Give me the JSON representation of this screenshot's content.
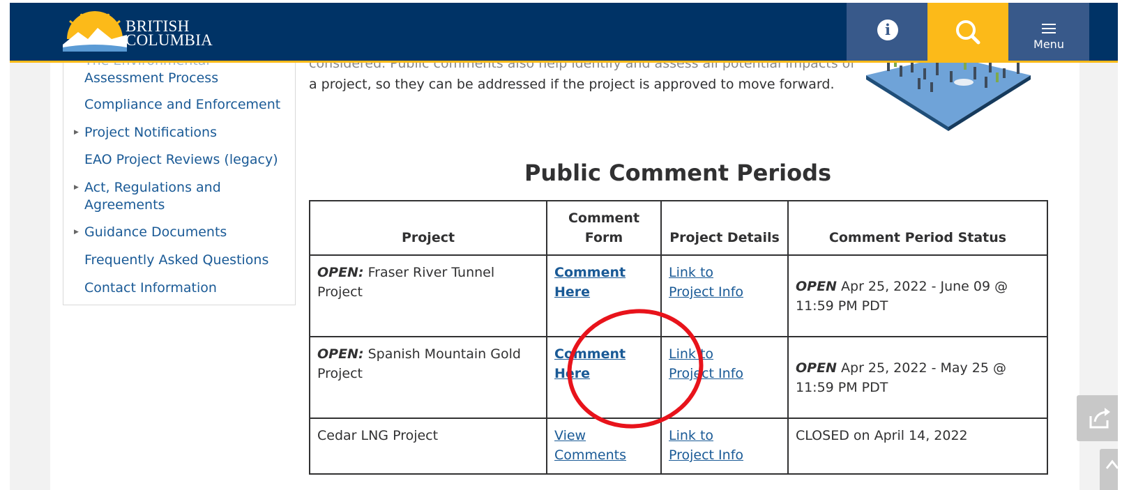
{
  "header": {
    "logo_line1": "BRITISH",
    "logo_line2": "COLUMBIA",
    "info_icon": "info-icon",
    "search_icon": "search-icon",
    "menu_icon": "hamburger-menu-icon",
    "menu_label": "Menu",
    "colors": {
      "bar": "#003366",
      "accent": "#fcba19",
      "button": "#38598a"
    }
  },
  "sidebar": {
    "items": [
      {
        "label": "The Environmental Assessment Process",
        "line1": "The Environmental",
        "line2": "Assessment Process",
        "expandable": false
      },
      {
        "label": "Compliance and Enforcement",
        "expandable": false
      },
      {
        "label": "Project Notifications",
        "expandable": true
      },
      {
        "label": "EAO Project Reviews (legacy)",
        "expandable": false
      },
      {
        "label": "Act, Regulations and Agreements",
        "line1": "Act, Regulations and",
        "line2": "Agreements",
        "expandable": true
      },
      {
        "label": "Guidance Documents",
        "expandable": true
      },
      {
        "label": "Frequently Asked Questions",
        "expandable": false
      },
      {
        "label": "Contact Information",
        "expandable": false
      }
    ]
  },
  "main": {
    "intro_line1": "considered. Public comments also help identify and assess all potential impacts of",
    "intro_line2": "a project, so they can be addressed if the project is approved to move forward.",
    "section_title": "Public Comment Periods",
    "table": {
      "headers": [
        "Project",
        "Comment Form",
        "Project Details",
        "Comment Period Status"
      ],
      "header_comment_form_line1": "Comment",
      "header_comment_form_line2": "Form",
      "rows": [
        {
          "project_prefix": "OPEN:",
          "project_name": "Fraser River Tunnel Project",
          "comment_link_line1": "Comment",
          "comment_link_line2": "Here",
          "details_link_line1": "Link to",
          "details_link_line2": "Project Info",
          "status_prefix": "OPEN",
          "status_text": "Apr 25, 2022 - June 09 @ 11:59 PM PDT"
        },
        {
          "project_prefix": "OPEN:",
          "project_name": "Spanish Mountain Gold Project",
          "comment_link_line1": "Comment",
          "comment_link_line2": "Here",
          "details_link_line1": "Link to",
          "details_link_line2": "Project Info",
          "status_prefix": "OPEN",
          "status_text": "Apr 25, 2022 - May 25 @ 11:59 PM PDT"
        },
        {
          "project_prefix": "",
          "project_name": "Cedar LNG Project",
          "comment_link_line1": "View",
          "comment_link_line2": "Comments",
          "details_link_line1": "Link to",
          "details_link_line2": "Project Info",
          "status_prefix": "",
          "status_text": "CLOSED on April 14, 2022"
        }
      ]
    }
  },
  "floating": {
    "share_icon": "share-icon",
    "back_to_top_icon": "chevron-up-icon"
  },
  "annotation": {
    "type": "highlight-circle",
    "color": "#e8131b",
    "target": "Spanish Mountain Gold Project comment link"
  }
}
